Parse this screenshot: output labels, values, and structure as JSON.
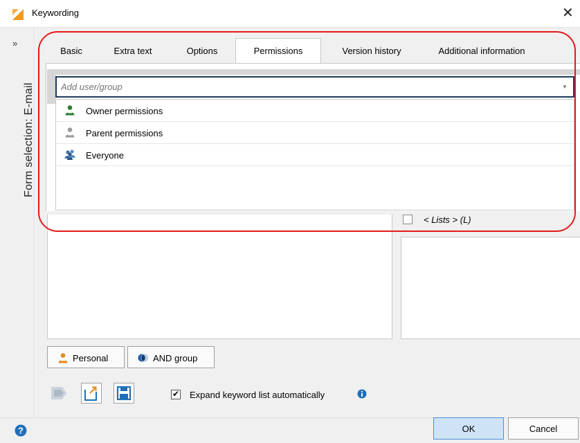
{
  "window": {
    "title": "Keywording",
    "close_glyph": "✕"
  },
  "sidebar": {
    "toggle_glyph": "»",
    "label": "Form selection: E-mail"
  },
  "tabs": [
    {
      "label": "Basic"
    },
    {
      "label": "Extra text"
    },
    {
      "label": "Options"
    },
    {
      "label": "Permissions",
      "active": true
    },
    {
      "label": "Version history"
    },
    {
      "label": "Additional information"
    }
  ],
  "permissions": {
    "add_placeholder": "Add user/group",
    "items": [
      {
        "label": "Owner permissions",
        "icon": "user-green-icon"
      },
      {
        "label": "Parent permissions",
        "icon": "user-gray-icon"
      },
      {
        "label": "Everyone",
        "icon": "group-users-icon"
      }
    ]
  },
  "lists": {
    "label": "< Lists > (L)",
    "checked": false
  },
  "buttons": {
    "personal": "Personal",
    "and_group": "AND group",
    "ok": "OK",
    "cancel": "Cancel"
  },
  "options": {
    "expand_label": "Expand keyword list automatically",
    "expand_checked": true,
    "check_glyph": "✔"
  },
  "colors": {
    "annotation": "#e31a1a",
    "accent": "#1e3a5a",
    "ok_button": "#cfe3f6"
  }
}
